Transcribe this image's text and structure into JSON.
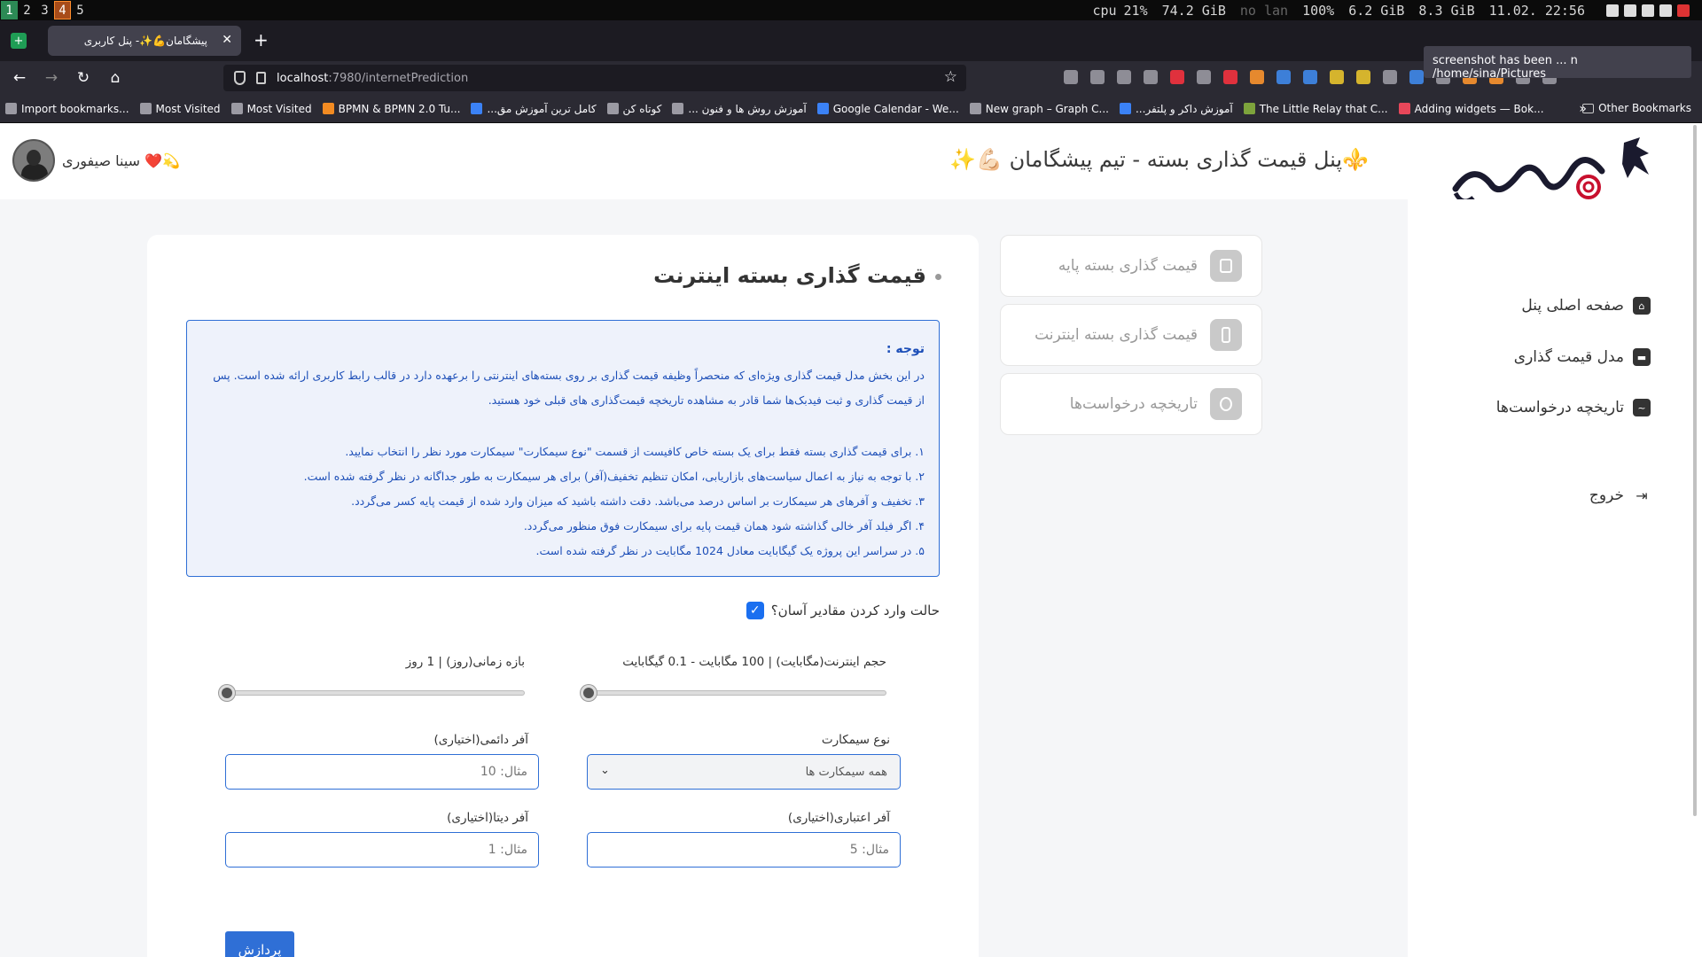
{
  "system_bar": {
    "workspaces": [
      "1",
      "2",
      "3",
      "4",
      "5"
    ],
    "cpu_label": "cpu",
    "cpu_value": "21%",
    "disk": "74.2 GiB",
    "lan": "no lan",
    "battery": "100%",
    "mem_used": "6.2 GiB",
    "mem_total": "8.3 GiB",
    "datetime": "11.02. 22:56"
  },
  "browser": {
    "tab_title": "پیشگامان💪✨- پنل کاربری",
    "url_host": "localhost",
    "url_path": ":7980/internetPrediction",
    "toast": "screenshot has been ... n /home/sina/Pictures",
    "bookmarks": [
      {
        "label": "Import bookmarks...",
        "icon": "import-icon"
      },
      {
        "label": "Most Visited",
        "icon": "gear-icon"
      },
      {
        "label": "Most Visited",
        "icon": "gear-icon"
      },
      {
        "label": "BPMN & BPMN 2.0 Tu...",
        "icon": "bpmn-icon"
      },
      {
        "label": "...کامل ترین آموزش مق",
        "icon": "site-icon"
      },
      {
        "label": "کوتاه کن",
        "icon": "globe-icon"
      },
      {
        "label": "... آموزش روش ها و فنون",
        "icon": "globe-icon"
      },
      {
        "label": "Google Calendar - We...",
        "icon": "calendar-icon"
      },
      {
        "label": "New graph – Graph C...",
        "icon": "graph-icon"
      },
      {
        "label": "...آموزش داکر و پلتفر",
        "icon": "docker-icon"
      },
      {
        "label": "The Little Relay that C...",
        "icon": "relay-icon"
      },
      {
        "label": "Adding widgets — Bok...",
        "icon": "bokeh-icon"
      }
    ],
    "other_bookmarks": "Other Bookmarks"
  },
  "header": {
    "title": "⚜️پنل قیمت گذاری بسته - تیم پیشگامان 💪🏻✨",
    "username": "💫❤️ سینا صیفوری"
  },
  "sidebar": {
    "items": [
      {
        "label": "صفحه اصلی پنل",
        "icon": "home-icon"
      },
      {
        "label": "مدل قیمت گذاری",
        "icon": "wallet-icon"
      },
      {
        "label": "تاریخچه درخواست‌ها",
        "icon": "history-icon"
      },
      {
        "label": "خروج",
        "icon": "logout-icon"
      }
    ]
  },
  "subnav": {
    "items": [
      {
        "label": "قیمت گذاری بسته پایه",
        "icon": "document-icon"
      },
      {
        "label": "قیمت گذاری بسته اینترنت",
        "icon": "phone-icon"
      },
      {
        "label": "تاریخچه درخواست‌ها",
        "icon": "chart-icon"
      }
    ]
  },
  "main": {
    "title": "قیمت گذاری بسته اینترنت",
    "notice_head": "توجه :",
    "notice_intro": "در این بخش مدل قیمت گذاری ویژه‌ای که منحصراً وظیفه قیمت گذاری بر روی بسته‌های اینترنتی را برعهده دارد در قالب رابط کاربری ارائه شده است. پس از قیمت گذاری و ثبت فیدبک‌ها شما قادر به مشاهده تاریخچه قیمت‌گذاری های قبلی خود هستید.",
    "notice_items": [
      "۱. برای قیمت گذاری بسته فقط برای یک بسته خاص کافیست از قسمت \"نوع سیمکارت\" سیمکارت مورد نظر را انتخاب نمایید.",
      "۲. با توجه به نیاز به اعمال سیاست‌های بازاریابی، امکان تنظیم تخفیف(آفر) برای هر سیمکارت به طور جداگانه در نظر گرفته شده است.",
      "۳. تخفیف و آفرهای هر سیمکارت بر اساس درصد می‌باشد. دقت داشته باشید که میزان وارد شده از قیمت پایه کسر می‌گردد.",
      "۴. اگر فیلد آفر خالی گذاشته شود همان قیمت پایه برای سیمکارت فوق منظور می‌گردد.",
      "۵. در سراسر این پروژه یک گیگابایت معادل 1024 مگابایت در نظر گرفته شده است."
    ],
    "easy_mode_label": "حالت وارد کردن مقادیر آسان؟",
    "easy_mode_checked": true,
    "volume_label": "حجم اینترنت(مگابایت) | 100 مگابایت - 0.1 گیگابایت",
    "volume_fraction": 0,
    "duration_label": "بازه زمانی(روز) | 1 روز",
    "duration_fraction": 0,
    "sim_type_label": "نوع سیمکارت",
    "sim_type_value": "همه سیمکارت ها",
    "permanent_offer_label": "آفر دائمی(اختیاری)",
    "permanent_offer_placeholder": "مثال: 10",
    "credit_offer_label": "آفر اعتباری(اختیاری)",
    "credit_offer_placeholder": "مثال: 5",
    "data_offer_label": "آفر دیتا(اختیاری)",
    "data_offer_placeholder": "مثال: 1",
    "submit_label": "پردازش"
  },
  "colors": {
    "accent": "#2f6fd6",
    "notice_bg": "#eef2fb",
    "notice_text": "#1d4fb8"
  }
}
